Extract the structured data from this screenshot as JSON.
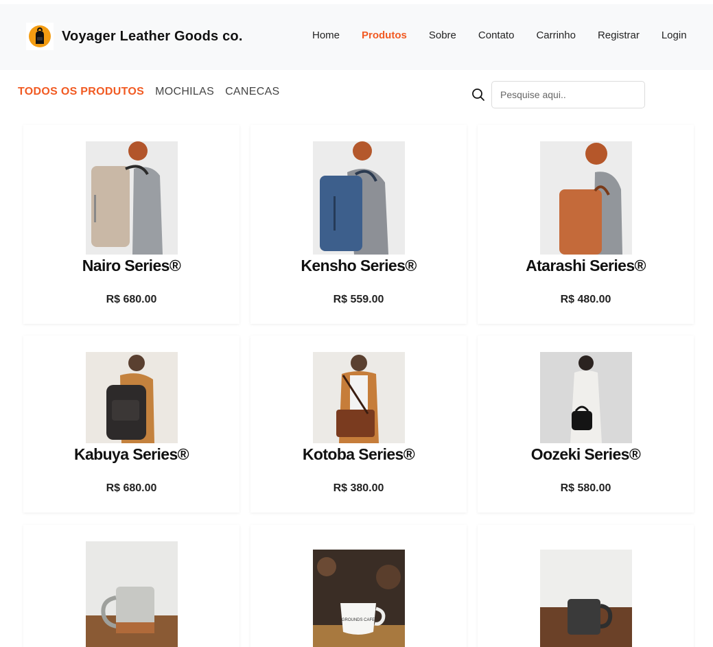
{
  "brand": {
    "name": "Voyager Leather Goods co.",
    "logo_icon": "backpack-icon",
    "accent": "#f15a22"
  },
  "nav": {
    "items": [
      "Home",
      "Produtos",
      "Sobre",
      "Contato",
      "Carrinho",
      "Registrar",
      "Login"
    ],
    "active": "Produtos"
  },
  "categories": {
    "items": [
      "TODOS OS PRODUTOS",
      "MOCHILAS",
      "CANECAS"
    ],
    "active": "TODOS OS PRODUTOS"
  },
  "search": {
    "placeholder": "Pesquise aqui..",
    "icon": "search-icon"
  },
  "products": [
    {
      "name": "Nairo Series®",
      "price": "R$ 680.00"
    },
    {
      "name": "Kensho Series®",
      "price": "R$ 559.00"
    },
    {
      "name": "Atarashi Series®",
      "price": "R$ 480.00"
    },
    {
      "name": "Kabuya Series®",
      "price": "R$ 680.00"
    },
    {
      "name": "Kotoba Series®",
      "price": "R$ 380.00"
    },
    {
      "name": "Oozeki Series®",
      "price": "R$ 580.00"
    },
    {
      "name": "",
      "price": ""
    },
    {
      "name": "",
      "price": ""
    },
    {
      "name": "",
      "price": ""
    }
  ],
  "mug_text": "GROUNDS CAFE"
}
